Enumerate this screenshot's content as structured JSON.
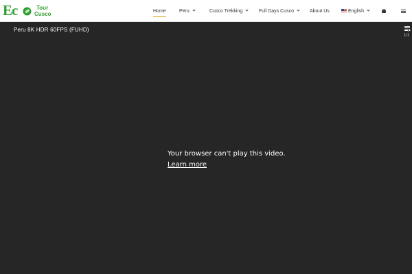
{
  "logo": {
    "eco": "Ec",
    "tour": "Tour",
    "cusco": "Cusco",
    "color": "#2f9e2f"
  },
  "nav": {
    "items": [
      {
        "label": "Home",
        "active": true,
        "dropdown": false
      },
      {
        "label": "Peru",
        "active": false,
        "dropdown": true
      },
      {
        "label": "Cusco Trekking",
        "active": false,
        "dropdown": true
      },
      {
        "label": "Full Days Cusco",
        "active": false,
        "dropdown": true
      },
      {
        "label": "About Us",
        "active": false,
        "dropdown": false
      },
      {
        "label": "English",
        "active": false,
        "dropdown": true,
        "flag": "us-flag-icon"
      }
    ],
    "active_underline_color": "#e6a21c",
    "cart_icon": "cart-icon",
    "menu_icon": "hamburger-menu-icon"
  },
  "video": {
    "title": "Peru 8K HDR 60FPS (FUHD)",
    "playlist_icon": "playlist-icon",
    "playlist_count": "1/1",
    "error_message": "Your browser can't play this video.",
    "error_link": "Learn more",
    "background": "#262626"
  }
}
